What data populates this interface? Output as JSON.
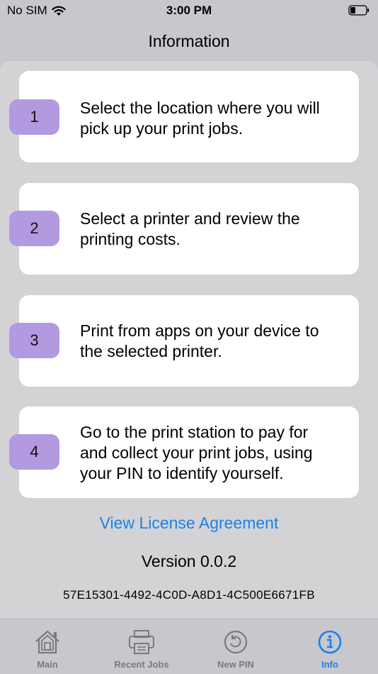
{
  "status_bar": {
    "carrier": "No SIM",
    "time": "3:00 PM"
  },
  "nav": {
    "title": "Information"
  },
  "steps": [
    {
      "number": "1",
      "line1": "Select the location where you will",
      "line2": "pick up your print jobs."
    },
    {
      "number": "2",
      "line1": "Select a printer and review the",
      "line2": "printing costs."
    },
    {
      "number": "3",
      "line1": "Print from apps on your device to",
      "line2": "the selected printer."
    },
    {
      "number": "4",
      "line1": "Go to the print station to pay for",
      "line2": "and collect your print jobs, using",
      "line3": "your PIN to identify yourself."
    }
  ],
  "license_link": "View License Agreement",
  "version": "Version 0.0.2",
  "device_id": "57E15301-4492-4C0D-A8D1-4C500E6671FB",
  "tabs": [
    {
      "label": "Main",
      "icon": "house-icon"
    },
    {
      "label": "Recent Jobs",
      "icon": "printer-icon"
    },
    {
      "label": "New PIN",
      "icon": "refresh-icon"
    },
    {
      "label": "Info",
      "icon": "info-icon",
      "active": true
    }
  ],
  "colors": {
    "accent": "#1a82e8",
    "badge": "#b39ae0",
    "background": "#c7c7cc"
  }
}
